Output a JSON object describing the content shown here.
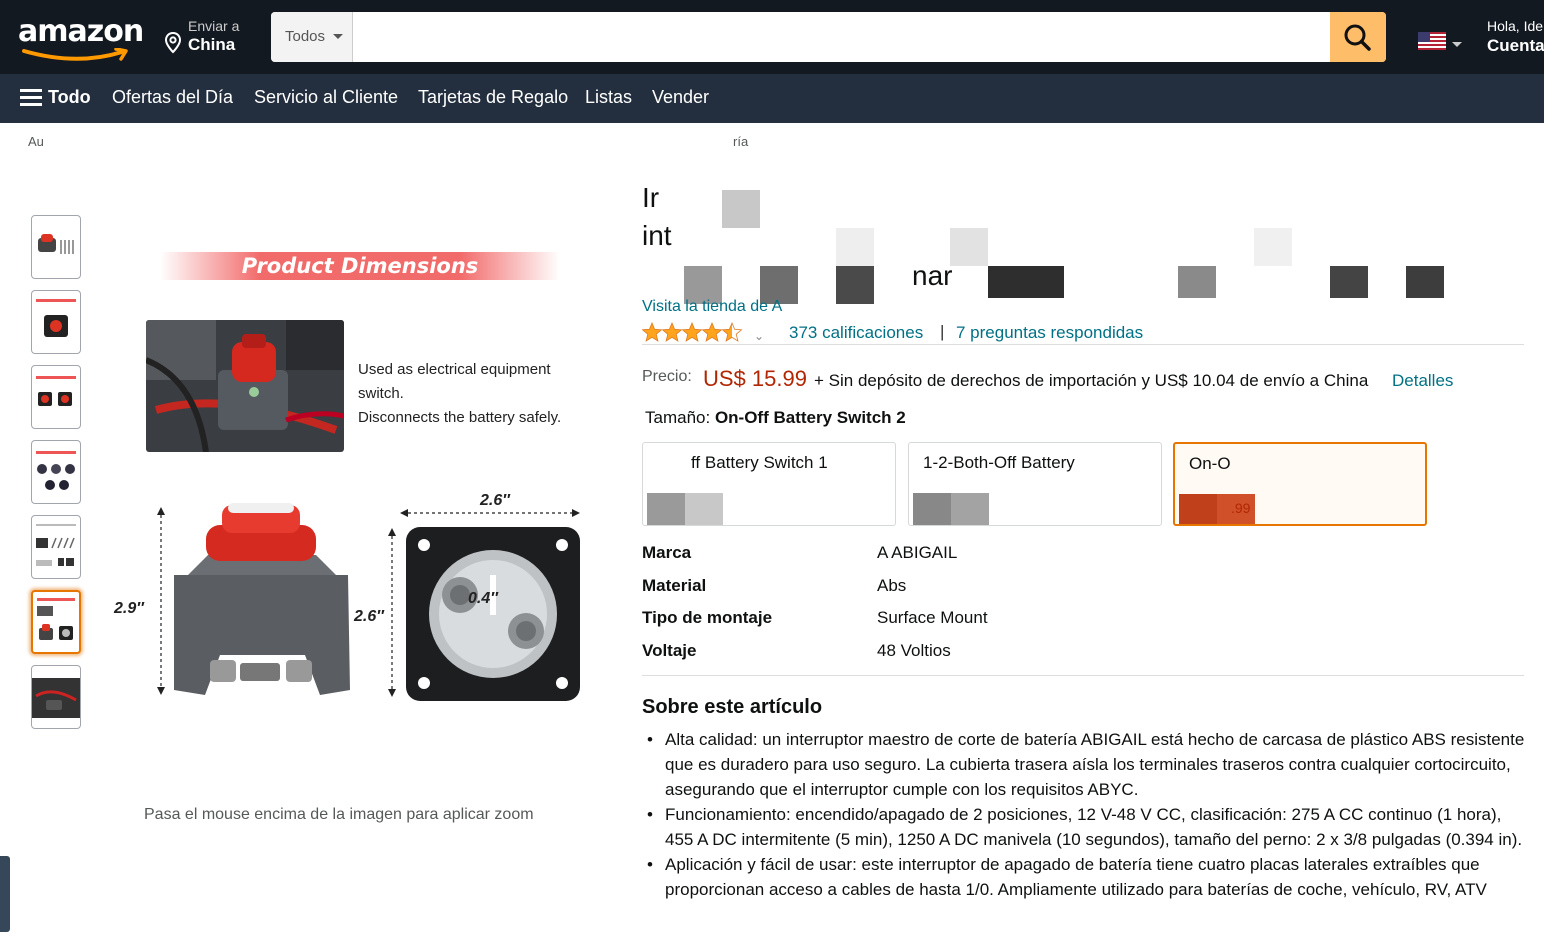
{
  "header": {
    "logo_text": "amazon",
    "deliver_line1": "Enviar a",
    "deliver_line2": "China",
    "search_category": "Todos",
    "search_placeholder": "",
    "account_line1": "Hola, Ide",
    "account_line2": "Cuenta"
  },
  "nav": {
    "all_label": "Todo",
    "items": [
      "Ofertas del Día",
      "Servicio al Cliente",
      "Tarjetas de Regalo",
      "Listas",
      "Vender"
    ]
  },
  "breadcrumb": {
    "start": "Au",
    "end": "ría"
  },
  "product": {
    "title_line1": "Ir",
    "title_line2": "int",
    "title_line3": "nar",
    "store_link": "Visita la tienda de A",
    "rating": 4.5,
    "ratings_count": "373 calificaciones",
    "qa_count": "7 preguntas respondidas",
    "separator": "|",
    "price_label": "Precio:",
    "price": "US$ 15.99",
    "price_note": "+ Sin depósito de derechos de importación y US$ 10.04 de envío a China",
    "price_details": "Detalles",
    "size_label": "Tamaño: ",
    "size_value": "On-Off Battery Switch 2",
    "options": [
      {
        "name": "ff Battery Switch 1",
        "price": ""
      },
      {
        "name": "1-2-Both-Off Battery",
        "price": ""
      },
      {
        "name": "On-O",
        "price": ".99"
      }
    ],
    "specs": [
      {
        "k": "Marca",
        "v": "A ABIGAIL"
      },
      {
        "k": "Material",
        "v": "Abs"
      },
      {
        "k": "Tipo de montaje",
        "v": "Surface Mount"
      },
      {
        "k": "Voltaje",
        "v": "48 Voltios"
      }
    ],
    "about_heading": "Sobre este artículo",
    "bullets": [
      "Alta calidad: un interruptor maestro de corte de batería ABIGAIL está hecho de carcasa de plástico ABS resistente que es duradero para uso seguro. La cubierta trasera aísla los terminales traseros contra cualquier cortocircuito, asegurando que el interruptor cumple con los requisitos ABYC.",
      "Funcionamiento: encendido/apagado de 2 posiciones, 12 V-48 V CC, clasificación: 275 A CC continuo (1 hora), 455 A DC intermitente (5 min), 1250 A DC manivela (10 segundos), tamaño del perno: 2 x 3/8 pulgadas (0.394 in).",
      "Aplicación y fácil de usar: este interruptor de apagado de batería tiene cuatro placas laterales extraíbles que proporcionan acceso a cables de hasta 1/0. Ampliamente utilizado para baterías de coche, vehículo, RV, ATV"
    ]
  },
  "image": {
    "banner": "Product Dimensions",
    "desc_line1": "Used as electrical equipment",
    "desc_line2": "switch.",
    "desc_line3": "Disconnects the battery safely.",
    "dim_height": "2.9″",
    "dim_width_top": "2.6″",
    "dim_side": "2.6″",
    "dim_bolt": "0.4″",
    "zoom_hint": "Pasa el mouse encima de la imagen para aplicar zoom"
  },
  "colors": {
    "nav_dark": "#131921",
    "nav_secondary": "#232f3e",
    "search_button": "#febd69",
    "price": "#b12704",
    "link": "#007185",
    "selected_border": "#e77600"
  }
}
